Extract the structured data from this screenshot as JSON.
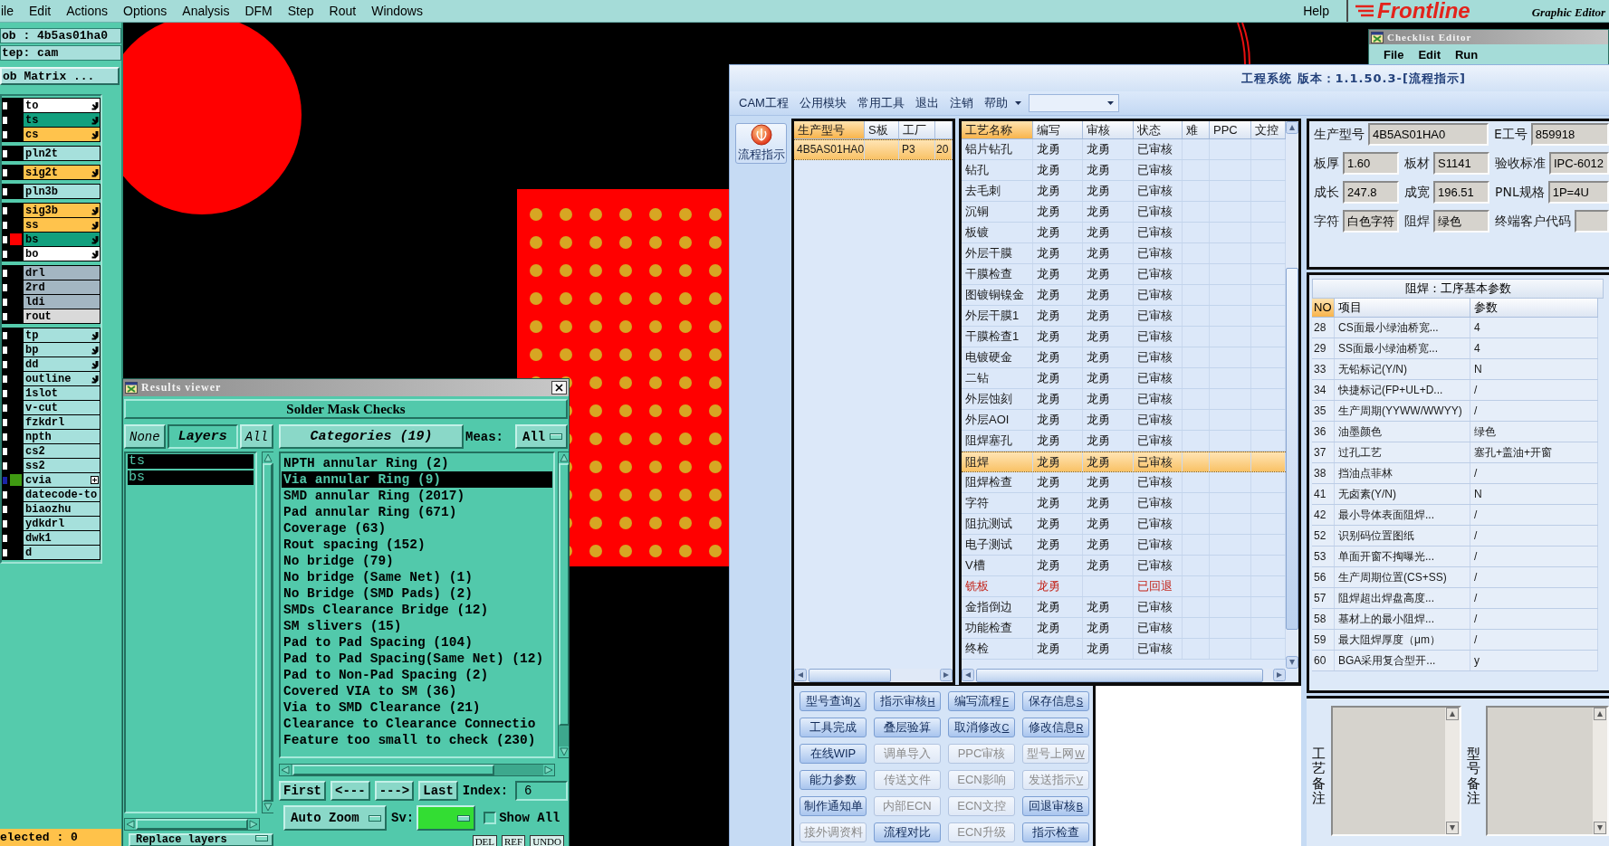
{
  "menu_bar": {
    "items": [
      "ile",
      "Edit",
      "Actions",
      "Options",
      "Analysis",
      "DFM",
      "Step",
      "Rout",
      "Windows"
    ],
    "help": "Help",
    "logo": "Frontline",
    "subtitle": "Graphic Editor"
  },
  "job_panel": {
    "job": "ob : 4b5as01ha0",
    "step": "tep: cam",
    "matrix_button": "ob Matrix ...",
    "layer_groups": [
      [
        {
          "name": "to",
          "color": "#ffffff",
          "checked": false,
          "tagged": true,
          "expandable": false
        },
        {
          "name": "ts",
          "color": "#12a07e",
          "checked": false,
          "tagged": true,
          "expandable": false
        },
        {
          "name": "cs",
          "color": "#ffc34c",
          "checked": false,
          "tagged": true,
          "expandable": false
        }
      ],
      [
        {
          "name": "pln2t",
          "color": "#a6e0dc",
          "checked": false,
          "tagged": false,
          "expandable": false
        }
      ],
      [
        {
          "name": "sig2t",
          "color": "#ffc34c",
          "checked": false,
          "tagged": true,
          "expandable": false
        }
      ],
      [
        {
          "name": "pln3b",
          "color": "#a6e0dc",
          "checked": false,
          "tagged": false,
          "expandable": false
        }
      ],
      [
        {
          "name": "sig3b",
          "color": "#ffc34c",
          "checked": false,
          "tagged": true,
          "expandable": false
        },
        {
          "name": "ss",
          "color": "#ffc34c",
          "checked": false,
          "tagged": true,
          "expandable": false
        },
        {
          "name": "bs",
          "color": "#12a07e",
          "display": {
            "color": "#ff0000"
          },
          "checked": false,
          "tagged": true,
          "expandable": false
        },
        {
          "name": "bo",
          "color": "#ffffff",
          "checked": false,
          "tagged": true,
          "expandable": false
        }
      ],
      [
        {
          "name": "drl",
          "color": "#a3b6c2",
          "checked": false,
          "tagged": false,
          "expandable": false
        },
        {
          "name": "2rd",
          "color": "#a3b6c2",
          "checked": false,
          "tagged": false,
          "expandable": false
        },
        {
          "name": "ldi",
          "color": "#a3b6c2",
          "checked": false,
          "tagged": false,
          "expandable": false
        },
        {
          "name": "rout",
          "color": "#d9d9d9",
          "checked": false,
          "tagged": false,
          "expandable": false
        }
      ],
      [
        {
          "name": "tp",
          "color": "#a6e0dc",
          "checked": false,
          "tagged": true,
          "expandable": false
        },
        {
          "name": "bp",
          "color": "#a6e0dc",
          "checked": false,
          "tagged": true,
          "expandable": false
        },
        {
          "name": "dd",
          "color": "#a6e0dc",
          "checked": false,
          "tagged": true,
          "expandable": false
        },
        {
          "name": "outline",
          "color": "#a6e0dc",
          "checked": false,
          "tagged": true,
          "expandable": false
        },
        {
          "name": "1slot",
          "color": "#a6e0dc",
          "checked": false,
          "tagged": false,
          "expandable": false
        },
        {
          "name": "v-cut",
          "color": "#a6e0dc",
          "checked": false,
          "tagged": false,
          "expandable": false
        },
        {
          "name": "fzkdrl",
          "color": "#a6e0dc",
          "checked": false,
          "tagged": false,
          "expandable": false
        },
        {
          "name": "npth",
          "color": "#a6e0dc",
          "checked": false,
          "tagged": false,
          "expandable": false
        },
        {
          "name": "cs2",
          "color": "#a6e0dc",
          "checked": false,
          "tagged": false,
          "expandable": false
        },
        {
          "name": "ss2",
          "color": "#a6e0dc",
          "checked": false,
          "tagged": false,
          "expandable": false
        },
        {
          "name": "cvia",
          "color": "#a6e0dc",
          "display": {
            "color": "#3f9a12"
          },
          "checked": true,
          "tagged": false,
          "expandable": true
        },
        {
          "name": "datecode-to",
          "color": "#a6e0dc",
          "checked": false,
          "tagged": false,
          "expandable": false
        },
        {
          "name": "biaozhu",
          "color": "#a6e0dc",
          "checked": false,
          "tagged": false,
          "expandable": false
        },
        {
          "name": "ydkdrl",
          "color": "#a6e0dc",
          "checked": false,
          "tagged": false,
          "expandable": false
        },
        {
          "name": "dwk1",
          "color": "#a6e0dc",
          "checked": false,
          "tagged": false,
          "expandable": false
        },
        {
          "name": "d",
          "color": "#a6e0dc",
          "checked": false,
          "tagged": false,
          "expandable": false
        }
      ]
    ],
    "status": "elected : 0"
  },
  "checklist_editor": {
    "title": "Checklist Editor",
    "menu": [
      "File",
      "Edit",
      "Run"
    ]
  },
  "results_viewer": {
    "title": "Results viewer",
    "heading": "Solder Mask Checks",
    "layer_filter_buttons": [
      {
        "label": "None",
        "kind": "button"
      },
      {
        "label": "Layers",
        "kind": "title"
      },
      {
        "label": "All",
        "kind": "button"
      }
    ],
    "layers": [
      {
        "name": "ts",
        "selected": true
      },
      {
        "name": "bs",
        "selected": true
      }
    ],
    "categories_button": "Categories (19)",
    "meas_label": "Meas:",
    "meas_value": "All",
    "categories": [
      {
        "label": "NPTH annular Ring (2)",
        "selected": false
      },
      {
        "label": "Via annular Ring (9)",
        "selected": true
      },
      {
        "label": "SMD annular Ring (2017)",
        "selected": false
      },
      {
        "label": "Pad annular Ring (671)",
        "selected": false
      },
      {
        "label": "Coverage (63)",
        "selected": false
      },
      {
        "label": "Rout spacing (152)",
        "selected": false
      },
      {
        "label": "No bridge (79)",
        "selected": false
      },
      {
        "label": "No bridge (Same Net) (1)",
        "selected": false
      },
      {
        "label": "No Bridge (SMD Pads) (2)",
        "selected": false
      },
      {
        "label": "SMDs Clearance Bridge (12)",
        "selected": false
      },
      {
        "label": "SM slivers (15)",
        "selected": false
      },
      {
        "label": "Pad to Pad Spacing (104)",
        "selected": false
      },
      {
        "label": "Pad to Pad Spacing(Same Net) (12)",
        "selected": false
      },
      {
        "label": "Pad to Non-Pad Spacing (2)",
        "selected": false
      },
      {
        "label": "Covered VIA to SM (36)",
        "selected": false
      },
      {
        "label": "Via to SMD Clearance (21)",
        "selected": false
      },
      {
        "label": "Clearance to Clearance Connectio",
        "selected": false
      },
      {
        "label": "Feature too small to check (230)",
        "selected": false
      }
    ],
    "nav_buttons": [
      "First",
      "<---",
      "--->",
      "Last"
    ],
    "index_label": "Index:",
    "index_value": "6",
    "zoom_mode": "Auto Zoom",
    "sv_label": "Sv:",
    "show_all": {
      "label": "Show All",
      "checked": false
    },
    "replace_button": "Replace layers",
    "action_buttons": [
      "DEL",
      "REF",
      "UNDO"
    ]
  },
  "engineering_window": {
    "title": "工程系统 版本：1.1.50.3-[流程指示]",
    "menu": [
      "CAM工程",
      "公用模块",
      "常用工具",
      "退出",
      "注销",
      "帮助"
    ],
    "side_button": "流程指示",
    "model_table": {
      "columns": [
        {
          "label": "生产型号",
          "sorted": true
        },
        {
          "label": "S板",
          "sorted": false
        },
        {
          "label": "工厂",
          "sorted": false
        }
      ],
      "rows": [
        {
          "model": "4B5AS01HA0",
          "factory": "P3",
          "column_4": "20",
          "selected": true
        }
      ]
    },
    "process_table": {
      "columns": [
        {
          "label": "工艺名称",
          "sorted": true
        },
        {
          "label": "编写",
          "sorted": false
        },
        {
          "label": "审核",
          "sorted": false
        },
        {
          "label": "状态",
          "sorted": false
        },
        {
          "label": "难",
          "sorted": false
        },
        {
          "label": "PPC",
          "sorted": false
        },
        {
          "label": "文控",
          "sorted": false
        }
      ],
      "rows": [
        {
          "step": "铝片钻孔",
          "author": "龙勇",
          "reviewer": "龙勇",
          "status": "已审核",
          "selected": false,
          "returned": false
        },
        {
          "step": "钻孔",
          "author": "龙勇",
          "reviewer": "龙勇",
          "status": "已审核",
          "selected": false,
          "returned": false
        },
        {
          "step": "去毛刺",
          "author": "龙勇",
          "reviewer": "龙勇",
          "status": "已审核",
          "selected": false,
          "returned": false
        },
        {
          "step": "沉铜",
          "author": "龙勇",
          "reviewer": "龙勇",
          "status": "已审核",
          "selected": false,
          "returned": false
        },
        {
          "step": "板镀",
          "author": "龙勇",
          "reviewer": "龙勇",
          "status": "已审核",
          "selected": false,
          "returned": false
        },
        {
          "step": "外层干膜",
          "author": "龙勇",
          "reviewer": "龙勇",
          "status": "已审核",
          "selected": false,
          "returned": false
        },
        {
          "step": "干膜检查",
          "author": "龙勇",
          "reviewer": "龙勇",
          "status": "已审核",
          "selected": false,
          "returned": false
        },
        {
          "step": "图镀铜镍金",
          "author": "龙勇",
          "reviewer": "龙勇",
          "status": "已审核",
          "selected": false,
          "returned": false
        },
        {
          "step": "外层干膜1",
          "author": "龙勇",
          "reviewer": "龙勇",
          "status": "已审核",
          "selected": false,
          "returned": false
        },
        {
          "step": "干膜检查1",
          "author": "龙勇",
          "reviewer": "龙勇",
          "status": "已审核",
          "selected": false,
          "returned": false
        },
        {
          "step": "电镀硬金",
          "author": "龙勇",
          "reviewer": "龙勇",
          "status": "已审核",
          "selected": false,
          "returned": false
        },
        {
          "step": "二钻",
          "author": "龙勇",
          "reviewer": "龙勇",
          "status": "已审核",
          "selected": false,
          "returned": false
        },
        {
          "step": "外层蚀刻",
          "author": "龙勇",
          "reviewer": "龙勇",
          "status": "已审核",
          "selected": false,
          "returned": false
        },
        {
          "step": "外层AOI",
          "author": "龙勇",
          "reviewer": "龙勇",
          "status": "已审核",
          "selected": false,
          "returned": false
        },
        {
          "step": "阻焊塞孔",
          "author": "龙勇",
          "reviewer": "龙勇",
          "status": "已审核",
          "selected": false,
          "returned": false
        },
        {
          "step": "阻焊",
          "author": "龙勇",
          "reviewer": "龙勇",
          "status": "已审核",
          "selected": true,
          "returned": false
        },
        {
          "step": "阻焊检查",
          "author": "龙勇",
          "reviewer": "龙勇",
          "status": "已审核",
          "selected": false,
          "returned": false
        },
        {
          "step": "字符",
          "author": "龙勇",
          "reviewer": "龙勇",
          "status": "已审核",
          "selected": false,
          "returned": false
        },
        {
          "step": "阻抗测试",
          "author": "龙勇",
          "reviewer": "龙勇",
          "status": "已审核",
          "selected": false,
          "returned": false
        },
        {
          "step": "电子测试",
          "author": "龙勇",
          "reviewer": "龙勇",
          "status": "已审核",
          "selected": false,
          "returned": false
        },
        {
          "step": "V槽",
          "author": "龙勇",
          "reviewer": "龙勇",
          "status": "已审核",
          "selected": false,
          "returned": false
        },
        {
          "step": "铣板",
          "author": "龙勇",
          "status": "已回退",
          "selected": false,
          "returned": true
        },
        {
          "step": "金指倒边",
          "author": "龙勇",
          "reviewer": "龙勇",
          "status": "已审核",
          "selected": false,
          "returned": false
        },
        {
          "step": "功能检查",
          "author": "龙勇",
          "reviewer": "龙勇",
          "status": "已审核",
          "selected": false,
          "returned": false
        },
        {
          "step": "终检",
          "author": "龙勇",
          "reviewer": "龙勇",
          "status": "已审核",
          "selected": false,
          "returned": false
        }
      ]
    },
    "action_buttons": [
      {
        "label": "型号查询",
        "hotkey": "X",
        "disabled": false
      },
      {
        "label": "指示审核",
        "hotkey": "H",
        "disabled": false
      },
      {
        "label": "编写流程",
        "hotkey": "F",
        "disabled": false
      },
      {
        "label": "保存信息",
        "hotkey": "S",
        "disabled": false
      },
      {
        "label": "工具完成",
        "disabled": false
      },
      {
        "label": "叠层验算",
        "disabled": false
      },
      {
        "label": "取消修改",
        "hotkey": "C",
        "disabled": false
      },
      {
        "label": "修改信息",
        "hotkey": "R",
        "disabled": false
      },
      {
        "label": "在线WIP",
        "disabled": false
      },
      {
        "label": "调单导入",
        "disabled": true
      },
      {
        "label": "PPC审核",
        "disabled": true
      },
      {
        "label": "型号上网",
        "hotkey": "W",
        "disabled": true
      },
      {
        "label": "能力参数",
        "disabled": false
      },
      {
        "label": "传送文件",
        "disabled": true
      },
      {
        "label": "ECN影响",
        "disabled": true
      },
      {
        "label": "发送指示",
        "hotkey": "V",
        "disabled": true
      },
      {
        "label": "制作通知单",
        "disabled": false
      },
      {
        "label": "内部ECN",
        "disabled": true
      },
      {
        "label": "ECN文控",
        "disabled": true
      },
      {
        "label": "回退审核",
        "hotkey": "B",
        "disabled": false
      },
      {
        "label": "接外调资料",
        "disabled": true
      },
      {
        "label": "流程对比",
        "disabled": false
      },
      {
        "label": "ECN升级",
        "disabled": true
      },
      {
        "label": "指示检查",
        "disabled": false
      }
    ],
    "model_info": {
      "rows": [
        {
          "fields": [
            {
              "label": "生产型号",
              "value": "4B5AS01HA0"
            },
            {
              "label": "E工号",
              "value": "859918"
            }
          ]
        },
        {
          "fields": [
            {
              "label": "板厚",
              "value": "1.60"
            },
            {
              "label": "板材",
              "value": "S1141"
            },
            {
              "label": "验收标准",
              "value": "IPC-6012"
            }
          ]
        },
        {
          "fields": [
            {
              "label": "成长",
              "value": "247.8"
            },
            {
              "label": "成宽",
              "value": "196.51"
            },
            {
              "label": "PNL规格",
              "value": "1P=4U"
            }
          ]
        },
        {
          "fields": [
            {
              "label": "字符",
              "value": "白色字符"
            },
            {
              "label": "阻焊",
              "value": "绿色"
            },
            {
              "label": "终端客户代码"
            }
          ]
        }
      ]
    },
    "param_table": {
      "title": "阻焊：工序基本参数",
      "columns": [
        {
          "label": "NO",
          "sorted": true
        },
        {
          "label": "项目",
          "sorted": false
        },
        {
          "label": "参数",
          "sorted": false
        }
      ],
      "rows": [
        {
          "no": "28",
          "item": "CS面最小绿油桥宽...",
          "value": "4"
        },
        {
          "no": "29",
          "item": "SS面最小绿油桥宽...",
          "value": "4"
        },
        {
          "no": "33",
          "item": "无铅标记(Y/N)",
          "value": "N"
        },
        {
          "no": "34",
          "item": "快捷标记(FP+UL+D...",
          "value": "/"
        },
        {
          "no": "35",
          "item": "生产周期(YYWW/WWYY)",
          "value": "/"
        },
        {
          "no": "36",
          "item": "油墨颜色",
          "value": "绿色"
        },
        {
          "no": "37",
          "item": "过孔工艺",
          "value": "塞孔+盖油+开窗"
        },
        {
          "no": "38",
          "item": "挡油点菲林",
          "value": "/"
        },
        {
          "no": "41",
          "item": "无卤素(Y/N)",
          "value": "N"
        },
        {
          "no": "42",
          "item": "最小导体表面阻焊...",
          "value": "/"
        },
        {
          "no": "52",
          "item": "识别码位置图纸",
          "value": "/"
        },
        {
          "no": "53",
          "item": "单面开窗不掏曝光...",
          "value": "/"
        },
        {
          "no": "56",
          "item": "生产周期位置(CS+SS)",
          "value": "/"
        },
        {
          "no": "57",
          "item": "阻焊超出焊盘高度...",
          "value": "/"
        },
        {
          "no": "58",
          "item": "基材上的最小阻焊...",
          "value": "/"
        },
        {
          "no": "59",
          "item": "最大阻焊厚度（μm）",
          "value": "/"
        },
        {
          "no": "60",
          "item": "BGA采用复合型开...",
          "value": "y"
        }
      ]
    },
    "remarks": [
      {
        "label": "工艺备注"
      },
      {
        "label": "型号备注"
      }
    ]
  }
}
